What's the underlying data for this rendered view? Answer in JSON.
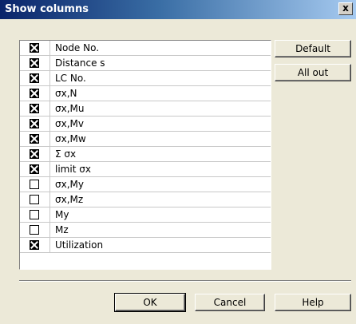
{
  "window": {
    "title": "Show columns",
    "close_label": "x"
  },
  "side_buttons": {
    "default_label": "Default",
    "all_out_label": "All out"
  },
  "columns": [
    {
      "label": "Node No.",
      "checked": true
    },
    {
      "label": "Distance s",
      "checked": true
    },
    {
      "label": "LC No.",
      "checked": true
    },
    {
      "label": "σx,N",
      "checked": true
    },
    {
      "label": "σx,Mu",
      "checked": true
    },
    {
      "label": "σx,Mv",
      "checked": true
    },
    {
      "label": "σx,Mw",
      "checked": true
    },
    {
      "label": "Σ σx",
      "checked": true
    },
    {
      "label": "limit σx",
      "checked": true
    },
    {
      "label": "σx,My",
      "checked": false
    },
    {
      "label": "σx,Mz",
      "checked": false
    },
    {
      "label": "My",
      "checked": false
    },
    {
      "label": "Mz",
      "checked": false
    },
    {
      "label": "Utilization",
      "checked": true
    }
  ],
  "footer": {
    "ok_label": "OK",
    "cancel_label": "Cancel",
    "help_label": "Help"
  }
}
